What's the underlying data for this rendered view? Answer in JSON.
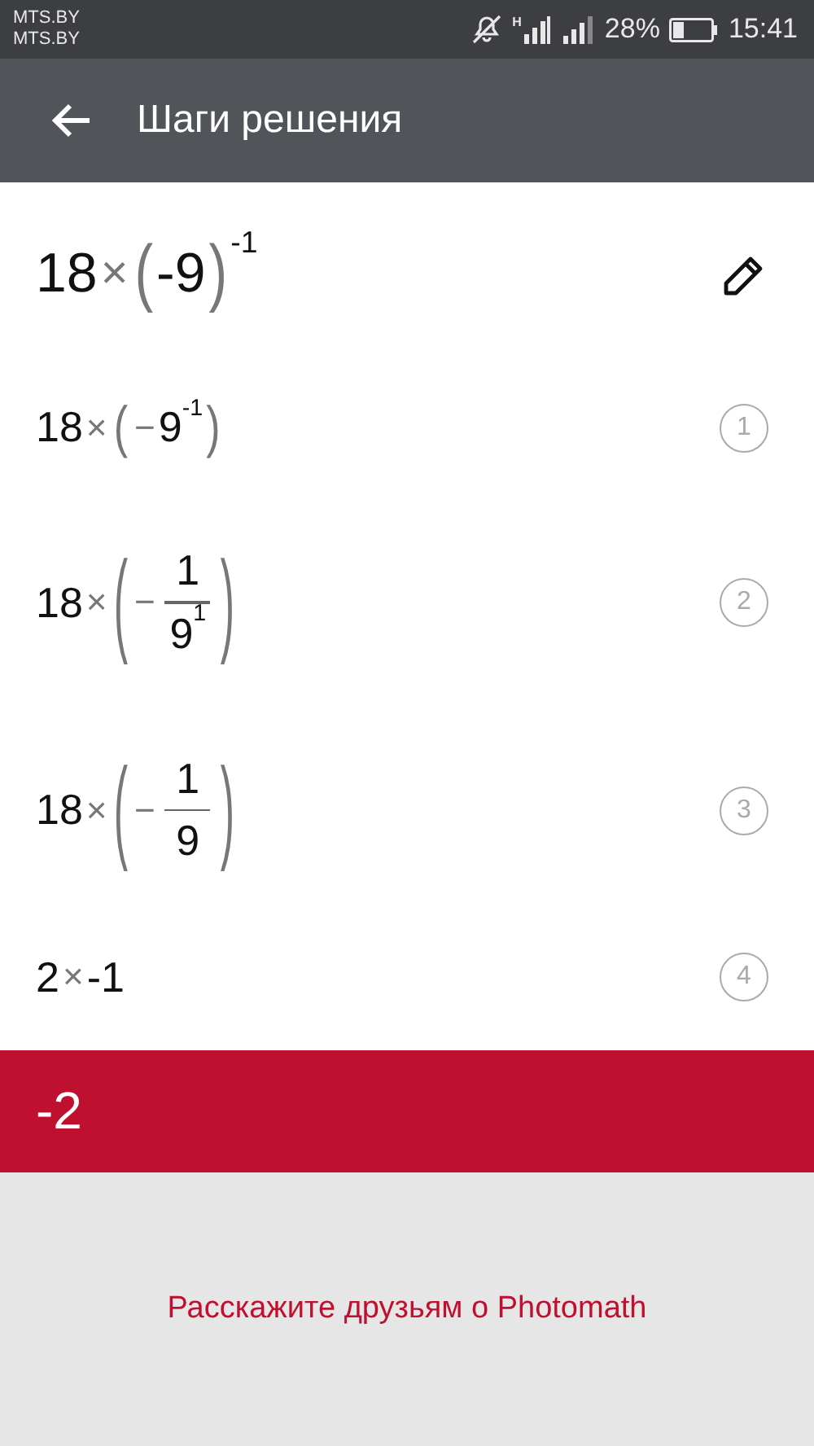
{
  "status_bar": {
    "carriers": [
      "MTS.BY",
      "MTS.BY"
    ],
    "network_type": "H",
    "battery": "28%",
    "time": "15:41"
  },
  "toolbar": {
    "title": "Шаги решения"
  },
  "problem": [
    {
      "kind": "num",
      "text": "18"
    },
    {
      "kind": "op",
      "text": "×"
    },
    {
      "kind": "group",
      "open": "(",
      "close": ")",
      "sup": "-1",
      "items": [
        {
          "kind": "num",
          "text": "-9"
        }
      ]
    }
  ],
  "steps": [
    {
      "number": "1",
      "expression": [
        {
          "kind": "num",
          "text": "18"
        },
        {
          "kind": "op",
          "text": "×"
        },
        {
          "kind": "group",
          "open": "(",
          "close": ")",
          "items": [
            {
              "kind": "op",
              "text": "−"
            },
            {
              "kind": "power",
              "base": "9",
              "exp": "-1"
            }
          ]
        }
      ]
    },
    {
      "number": "2",
      "expression": [
        {
          "kind": "num",
          "text": "18"
        },
        {
          "kind": "op",
          "text": "×"
        },
        {
          "kind": "group",
          "open": "(",
          "close": ")",
          "items": [
            {
              "kind": "op",
              "text": "−"
            },
            {
              "kind": "frac",
              "num": [
                {
                  "kind": "num",
                  "text": "1"
                }
              ],
              "den": [
                {
                  "kind": "power",
                  "base": "9",
                  "exp": "1"
                }
              ]
            }
          ]
        }
      ]
    },
    {
      "number": "3",
      "expression": [
        {
          "kind": "num",
          "text": "18"
        },
        {
          "kind": "op",
          "text": "×"
        },
        {
          "kind": "group",
          "open": "(",
          "close": ")",
          "items": [
            {
              "kind": "op",
              "text": "−"
            },
            {
              "kind": "frac",
              "num": [
                {
                  "kind": "num",
                  "text": "1"
                }
              ],
              "den": [
                {
                  "kind": "num",
                  "text": "9"
                }
              ]
            }
          ]
        }
      ]
    },
    {
      "number": "4",
      "expression": [
        {
          "kind": "num",
          "text": "2"
        },
        {
          "kind": "op",
          "text": "×"
        },
        {
          "kind": "num",
          "text": "-1"
        }
      ]
    }
  ],
  "result": "-2",
  "footer_link": "Расскажите друзьям о Photomath"
}
